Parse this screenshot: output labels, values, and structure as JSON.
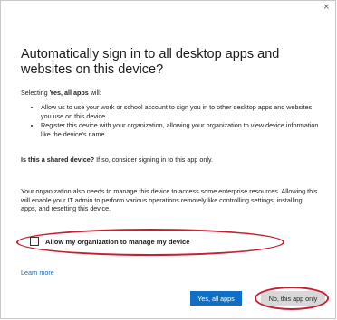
{
  "dialog": {
    "close_glyph": "×",
    "title": "Automatically sign in to all desktop apps and websites on this device?",
    "intro": {
      "prefix": "Selecting ",
      "bold": "Yes, all apps",
      "suffix": " will:"
    },
    "bullets": [
      "Allow us to use your work or school account to sign you in to other desktop apps and websites you use on this device.",
      "Register this device with your organization, allowing your organization to view device information like the device's name."
    ],
    "shared": {
      "bold": "Is this a shared device?",
      "rest": " If so, consider signing in to this app only."
    },
    "manage_text": "Your organization also needs to manage this device to access some enterprise resources. Allowing this will enable your IT admin to perform various operations remotely like controlling settings, installing apps, and resetting this device.",
    "checkbox": {
      "label": "Allow my organization to manage my device",
      "checked": false
    },
    "learn_more": "Learn more",
    "buttons": {
      "yes": "Yes, all apps",
      "no": "No, this app only"
    }
  },
  "colors": {
    "primary_button": "#0f6fc6",
    "secondary_button": "#d8d8d8",
    "link": "#1a6cb5",
    "annotation_ring": "#c52032"
  }
}
